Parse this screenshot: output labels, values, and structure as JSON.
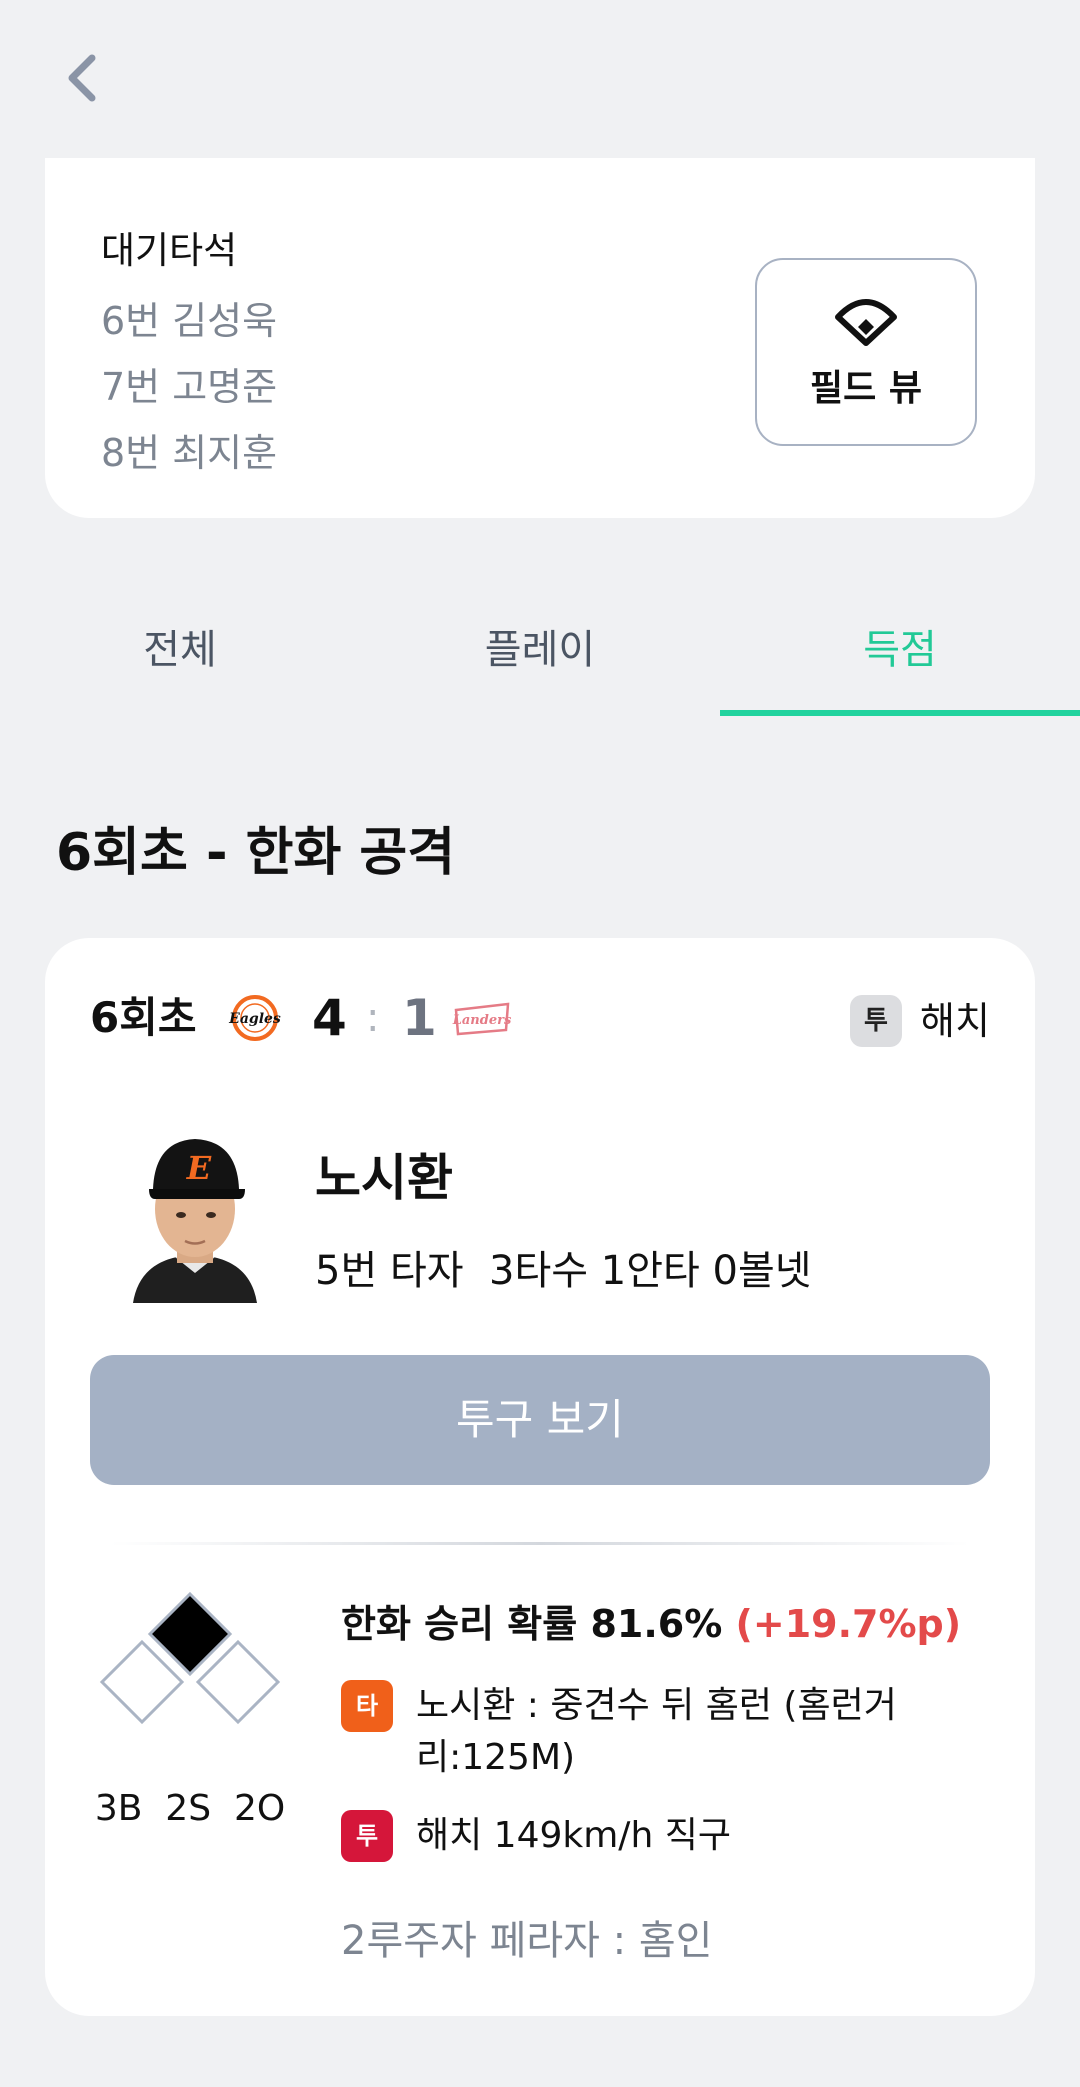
{
  "nav": {
    "back_icon": "chevron-left-icon"
  },
  "on_deck": {
    "title": "대기타석",
    "batters": [
      "6번 김성욱",
      "7번 고명준",
      "8번 최지훈"
    ],
    "field_view_label": "필드 뷰",
    "field_view_icon": "baseball-field-icon"
  },
  "tabs": [
    {
      "label": "전체",
      "active": false
    },
    {
      "label": "플레이",
      "active": false
    },
    {
      "label": "득점",
      "active": true
    }
  ],
  "section_title": "6회초 - 한화 공격",
  "scoreboard": {
    "inning": "6회초",
    "home_team_logo": "Eagles",
    "away_team_logo": "Landers",
    "home_score": "4",
    "separator": ":",
    "away_score": "1",
    "pitcher_badge": "투",
    "pitcher_name": "해치"
  },
  "batter": {
    "name": "노시환",
    "stats": "5번 타자  3타수 1안타 0볼넷"
  },
  "pitch_button_label": "투구 보기",
  "play": {
    "count": "3B  2S  2O",
    "bases": {
      "first": false,
      "second": true,
      "third": false
    },
    "win_prob_text": "한화 승리 확률 81.6%",
    "win_prob_delta": "(+19.7%p)",
    "bat_badge": "타",
    "bat_event": "노시환 : 중견수 뒤 홈런 (홈런거리:125M)",
    "pitch_badge": "투",
    "pitch_event": "해치 149km/h 직구",
    "runner_result": "2루주자 페라자 : 홈인"
  },
  "colors": {
    "background": "#f0f1f3",
    "accent": "#22d39e",
    "button_disabled": "#a4b1c5",
    "delta_red": "#e34a4a",
    "bat_badge": "#f0601a",
    "pitch_badge": "#d5163a"
  }
}
